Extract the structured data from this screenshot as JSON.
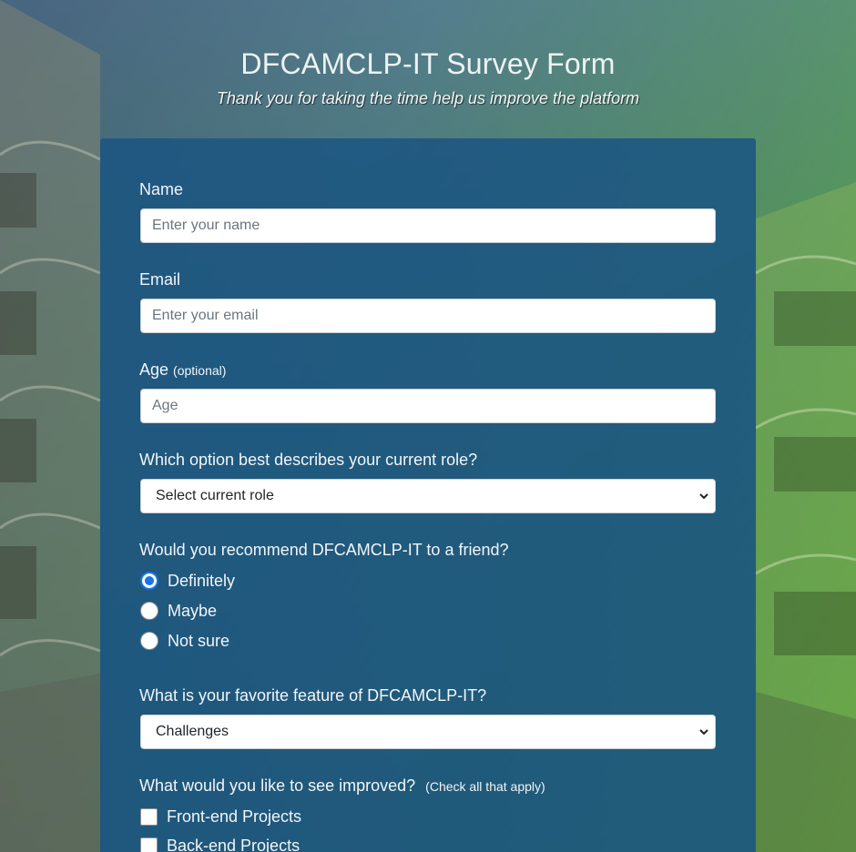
{
  "header": {
    "title": "DFCAMCLP-IT Survey Form",
    "subtitle": "Thank you for taking the time help us improve the platform"
  },
  "form": {
    "name": {
      "label": "Name",
      "placeholder": "Enter your name"
    },
    "email": {
      "label": "Email",
      "placeholder": "Enter your email"
    },
    "age": {
      "label": "Age",
      "label_note": "(optional)",
      "placeholder": "Age"
    },
    "role": {
      "label": "Which option best describes your current role?",
      "selected": "Select current role"
    },
    "recommend": {
      "label": "Would you recommend DFCAMCLP-IT to a friend?",
      "options": [
        {
          "label": "Definitely",
          "checked": true
        },
        {
          "label": "Maybe",
          "checked": false
        },
        {
          "label": "Not sure",
          "checked": false
        }
      ]
    },
    "feature": {
      "label": "What is your favorite feature of DFCAMCLP-IT?",
      "selected": "Challenges"
    },
    "improve": {
      "label": "What would you like to see improved?",
      "label_note": "(Check all that apply)",
      "options": [
        {
          "label": "Front-end Projects",
          "checked": false
        },
        {
          "label": "Back-end Projects",
          "checked": false
        }
      ]
    }
  },
  "colors": {
    "panel": "#1b5582",
    "accent": "#1a73e8"
  }
}
